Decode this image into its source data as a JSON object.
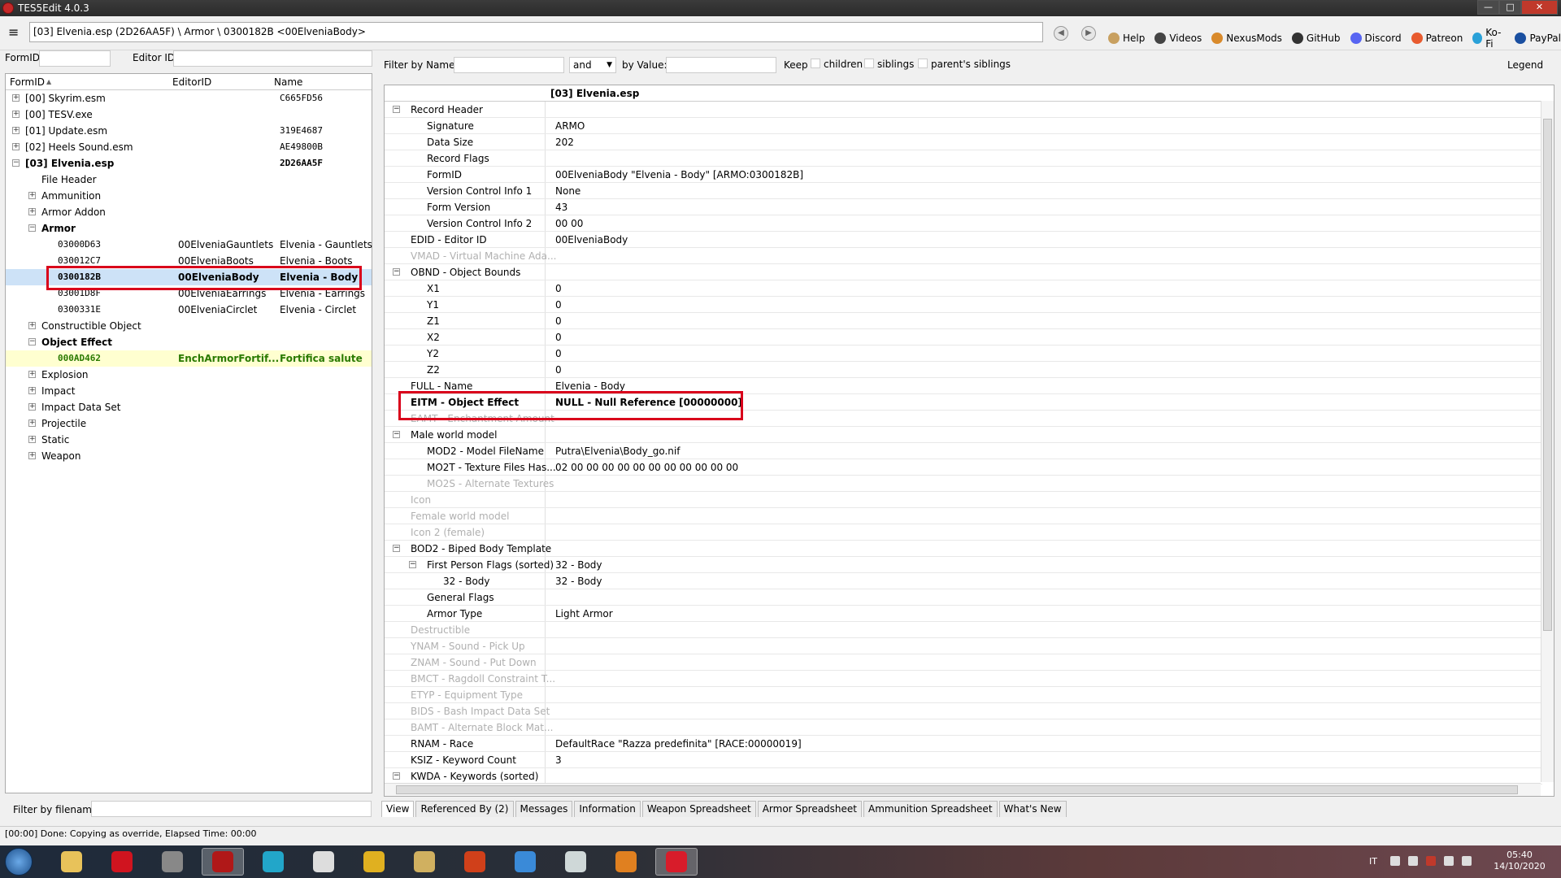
{
  "window": {
    "title": "TES5Edit 4.0.3",
    "min": "—",
    "max": "□",
    "close": "✕"
  },
  "toolbar": {
    "menu_icon": "≡",
    "path": "[03] Elvenia.esp (2D26AA5F) \\ Armor \\ 0300182B <00ElveniaBody>",
    "back": "◀",
    "forward": "▶",
    "links": [
      {
        "label": "Help",
        "icon": "book-icon",
        "color": "#c8a060"
      },
      {
        "label": "Videos",
        "icon": "video-icon",
        "color": "#444444"
      },
      {
        "label": "NexusMods",
        "icon": "nexus-icon",
        "color": "#d98a2b"
      },
      {
        "label": "GitHub",
        "icon": "github-icon",
        "color": "#333333"
      },
      {
        "label": "Discord",
        "icon": "discord-icon",
        "color": "#5865f2"
      },
      {
        "label": "Patreon",
        "icon": "patreon-icon",
        "color": "#e85b2f"
      },
      {
        "label": "Ko-Fi",
        "icon": "kofi-icon",
        "color": "#2aa1d8"
      },
      {
        "label": "PayPal",
        "icon": "paypal-icon",
        "color": "#1a4fa0"
      }
    ]
  },
  "left": {
    "formid_label": "FormID",
    "editorid_label": "Editor ID",
    "columns": [
      "FormID",
      "EditorID",
      "Name"
    ],
    "sort_indicator": "▲",
    "filter_label": "Filter by filename:",
    "rows": [
      {
        "indent": 0,
        "exp": "+",
        "c1": "[00] Skyrim.esm",
        "c2": "",
        "c3": "C665FD56",
        "style": "",
        "c1mono": false,
        "c3mono": true
      },
      {
        "indent": 0,
        "exp": "+",
        "c1": "[00] TESV.exe",
        "c2": "",
        "c3": "",
        "style": ""
      },
      {
        "indent": 0,
        "exp": "+",
        "c1": "[01] Update.esm",
        "c2": "",
        "c3": "319E4687",
        "style": "",
        "c3mono": true
      },
      {
        "indent": 0,
        "exp": "+",
        "c1": "[02] Heels Sound.esm",
        "c2": "",
        "c3": "AE49800B",
        "style": "",
        "c3mono": true
      },
      {
        "indent": 0,
        "exp": "−",
        "c1": "[03] Elvenia.esp",
        "c2": "",
        "c3": "2D26AA5F",
        "style": "bold",
        "c3mono": true
      },
      {
        "indent": 1,
        "exp": "",
        "c1": "File Header",
        "c2": "",
        "c3": "",
        "style": ""
      },
      {
        "indent": 1,
        "exp": "+",
        "c1": "Ammunition",
        "c2": "",
        "c3": "",
        "style": ""
      },
      {
        "indent": 1,
        "exp": "+",
        "c1": "Armor Addon",
        "c2": "",
        "c3": "",
        "style": ""
      },
      {
        "indent": 1,
        "exp": "−",
        "c1": "Armor",
        "c2": "",
        "c3": "",
        "style": "bold"
      },
      {
        "indent": 2,
        "exp": "",
        "c1": "03000D63",
        "c2": "00ElveniaGauntlets",
        "c3": "Elvenia - Gauntlets",
        "style": "",
        "c1mono": true
      },
      {
        "indent": 2,
        "exp": "",
        "c1": "030012C7",
        "c2": "00ElveniaBoots",
        "c3": "Elvenia - Boots",
        "style": "",
        "c1mono": true
      },
      {
        "indent": 2,
        "exp": "",
        "c1": "0300182B",
        "c2": "00ElveniaBody",
        "c3": "Elvenia - Body",
        "style": "sel",
        "c1mono": true
      },
      {
        "indent": 2,
        "exp": "",
        "c1": "03001D8F",
        "c2": "00ElveniaEarrings",
        "c3": "Elvenia - Earrings",
        "style": "",
        "c1mono": true
      },
      {
        "indent": 2,
        "exp": "",
        "c1": "0300331E",
        "c2": "00ElveniaCirclet",
        "c3": "Elvenia - Circlet",
        "style": "",
        "c1mono": true
      },
      {
        "indent": 1,
        "exp": "+",
        "c1": "Constructible Object",
        "c2": "",
        "c3": "",
        "style": ""
      },
      {
        "indent": 1,
        "exp": "−",
        "c1": "Object Effect",
        "c2": "",
        "c3": "",
        "style": "bold"
      },
      {
        "indent": 2,
        "exp": "",
        "c1": "000AD462",
        "c2": "EnchArmorFortif...",
        "c3": "Fortifica salute",
        "style": "green",
        "c1mono": true
      },
      {
        "indent": 1,
        "exp": "+",
        "c1": "Explosion",
        "c2": "",
        "c3": "",
        "style": ""
      },
      {
        "indent": 1,
        "exp": "+",
        "c1": "Impact",
        "c2": "",
        "c3": "",
        "style": ""
      },
      {
        "indent": 1,
        "exp": "+",
        "c1": "Impact Data Set",
        "c2": "",
        "c3": "",
        "style": ""
      },
      {
        "indent": 1,
        "exp": "+",
        "c1": "Projectile",
        "c2": "",
        "c3": "",
        "style": ""
      },
      {
        "indent": 1,
        "exp": "+",
        "c1": "Static",
        "c2": "",
        "c3": "",
        "style": ""
      },
      {
        "indent": 1,
        "exp": "+",
        "c1": "Weapon",
        "c2": "",
        "c3": "",
        "style": ""
      }
    ]
  },
  "filter": {
    "by_name": "Filter by Name:",
    "op": "and",
    "by_value": "by Value:",
    "keep": "Keep",
    "children": "children",
    "siblings": "siblings",
    "parents_siblings": "parent's siblings",
    "legend": "Legend"
  },
  "grid": {
    "header": "[03] Elvenia.esp",
    "rows": [
      {
        "lvl": 0,
        "exp": "−",
        "k": "Record Header",
        "v": "",
        "dim": false
      },
      {
        "lvl": 1,
        "exp": "",
        "k": "Signature",
        "v": "ARMO",
        "dim": false
      },
      {
        "lvl": 1,
        "exp": "",
        "k": "Data Size",
        "v": "202",
        "dim": false
      },
      {
        "lvl": 1,
        "exp": "",
        "k": "Record Flags",
        "v": "",
        "dim": false
      },
      {
        "lvl": 1,
        "exp": "",
        "k": "FormID",
        "v": "00ElveniaBody \"Elvenia - Body\" [ARMO:0300182B]",
        "dim": false
      },
      {
        "lvl": 1,
        "exp": "",
        "k": "Version Control Info 1",
        "v": "None",
        "dim": false
      },
      {
        "lvl": 1,
        "exp": "",
        "k": "Form Version",
        "v": "43",
        "dim": false
      },
      {
        "lvl": 1,
        "exp": "",
        "k": "Version Control Info 2",
        "v": "00 00",
        "dim": false
      },
      {
        "lvl": 0,
        "exp": "",
        "k": "EDID - Editor ID",
        "v": "00ElveniaBody",
        "dim": false
      },
      {
        "lvl": 0,
        "exp": "",
        "k": "VMAD - Virtual Machine Ada...",
        "v": "",
        "dim": true
      },
      {
        "lvl": 0,
        "exp": "−",
        "k": "OBND - Object Bounds",
        "v": "",
        "dim": false
      },
      {
        "lvl": 1,
        "exp": "",
        "k": "X1",
        "v": "0",
        "dim": false
      },
      {
        "lvl": 1,
        "exp": "",
        "k": "Y1",
        "v": "0",
        "dim": false
      },
      {
        "lvl": 1,
        "exp": "",
        "k": "Z1",
        "v": "0",
        "dim": false
      },
      {
        "lvl": 1,
        "exp": "",
        "k": "X2",
        "v": "0",
        "dim": false
      },
      {
        "lvl": 1,
        "exp": "",
        "k": "Y2",
        "v": "0",
        "dim": false
      },
      {
        "lvl": 1,
        "exp": "",
        "k": "Z2",
        "v": "0",
        "dim": false
      },
      {
        "lvl": 0,
        "exp": "",
        "k": "FULL - Name",
        "v": "Elvenia - Body",
        "dim": false
      },
      {
        "lvl": 0,
        "exp": "",
        "k": "EITM - Object Effect",
        "v": "NULL - Null Reference [00000000]",
        "dim": false,
        "bold": true
      },
      {
        "lvl": 0,
        "exp": "",
        "k": "EAMT - Enchantment Amount",
        "v": "",
        "dim": true
      },
      {
        "lvl": 0,
        "exp": "−",
        "k": "Male world model",
        "v": "",
        "dim": false
      },
      {
        "lvl": 1,
        "exp": "",
        "k": "MOD2 - Model FileName",
        "v": "Putra\\Elvenia\\Body_go.nif",
        "dim": false
      },
      {
        "lvl": 1,
        "exp": "",
        "k": "MO2T - Texture Files Has...",
        "v": "02 00 00 00 00 00 00 00 00 00 00 00",
        "dim": false
      },
      {
        "lvl": 1,
        "exp": "",
        "k": "MO2S - Alternate Textures",
        "v": "",
        "dim": true
      },
      {
        "lvl": 0,
        "exp": "",
        "k": "Icon",
        "v": "",
        "dim": true
      },
      {
        "lvl": 0,
        "exp": "",
        "k": "Female world model",
        "v": "",
        "dim": true
      },
      {
        "lvl": 0,
        "exp": "",
        "k": "Icon 2 (female)",
        "v": "",
        "dim": true
      },
      {
        "lvl": 0,
        "exp": "−",
        "k": "BOD2 - Biped Body Template",
        "v": "",
        "dim": false
      },
      {
        "lvl": 1,
        "exp": "−",
        "k": "First Person Flags (sorted)",
        "v": "32 - Body",
        "dim": false
      },
      {
        "lvl": 2,
        "exp": "",
        "k": "32 - Body",
        "v": "32 - Body",
        "dim": false
      },
      {
        "lvl": 1,
        "exp": "",
        "k": "General Flags",
        "v": "",
        "dim": false
      },
      {
        "lvl": 1,
        "exp": "",
        "k": "Armor Type",
        "v": "Light Armor",
        "dim": false
      },
      {
        "lvl": 0,
        "exp": "",
        "k": "Destructible",
        "v": "",
        "dim": true
      },
      {
        "lvl": 0,
        "exp": "",
        "k": "YNAM - Sound - Pick Up",
        "v": "",
        "dim": true
      },
      {
        "lvl": 0,
        "exp": "",
        "k": "ZNAM - Sound - Put Down",
        "v": "",
        "dim": true
      },
      {
        "lvl": 0,
        "exp": "",
        "k": "BMCT - Ragdoll Constraint T...",
        "v": "",
        "dim": true
      },
      {
        "lvl": 0,
        "exp": "",
        "k": "ETYP - Equipment Type",
        "v": "",
        "dim": true
      },
      {
        "lvl": 0,
        "exp": "",
        "k": "BIDS - Bash Impact Data Set",
        "v": "",
        "dim": true
      },
      {
        "lvl": 0,
        "exp": "",
        "k": "BAMT - Alternate Block Mat...",
        "v": "",
        "dim": true
      },
      {
        "lvl": 0,
        "exp": "",
        "k": "RNAM - Race",
        "v": "DefaultRace \"Razza predefinita\" [RACE:00000019]",
        "dim": false
      },
      {
        "lvl": 0,
        "exp": "",
        "k": "KSIZ - Keyword Count",
        "v": "3",
        "dim": false
      },
      {
        "lvl": 0,
        "exp": "−",
        "k": "KWDA - Keywords (sorted)",
        "v": "",
        "dim": false
      }
    ]
  },
  "tabs": [
    "View",
    "Referenced By (2)",
    "Messages",
    "Information",
    "Weapon Spreadsheet",
    "Armor Spreadsheet",
    "Ammunition Spreadsheet",
    "What's New"
  ],
  "status": "[00:00] Done: Copying as override, Elapsed Time: 00:00",
  "taskbar": {
    "apps": [
      {
        "name": "explorer-icon",
        "color": "#e8c25a"
      },
      {
        "name": "opera-icon",
        "color": "#d0141f"
      },
      {
        "name": "app-icon",
        "color": "#888888"
      },
      {
        "name": "tes5edit-icon",
        "color": "#b01818"
      },
      {
        "name": "music-icon",
        "color": "#22a6c9"
      },
      {
        "name": "audio-icon",
        "color": "#dddddd"
      },
      {
        "name": "notes-icon",
        "color": "#e0b020"
      },
      {
        "name": "arrow-icon",
        "color": "#d0b060"
      },
      {
        "name": "flash-icon",
        "color": "#d0401a"
      },
      {
        "name": "ffdec-icon",
        "color": "#3a8ad8"
      },
      {
        "name": "window-icon",
        "color": "#cfd8d8"
      },
      {
        "name": "tools-icon",
        "color": "#e08020"
      },
      {
        "name": "opera-gx-icon",
        "color": "#d81c2a"
      }
    ],
    "lang": "IT",
    "time": "05:40",
    "date": "14/10/2020"
  }
}
